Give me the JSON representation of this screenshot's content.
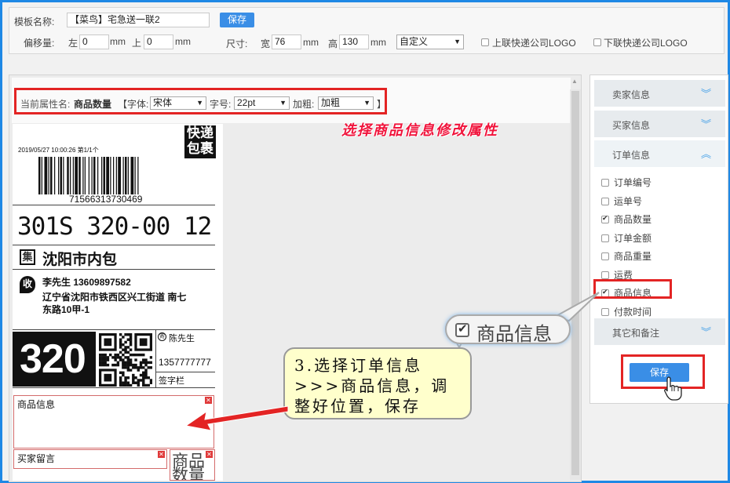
{
  "settings": {
    "template_name_label": "模板名称:",
    "template_name_value": "【菜鸟】宅急送一联2",
    "save_label": "保存",
    "offset_label": "偏移量:",
    "left_label": "左",
    "left_value": "0",
    "top_label": "上",
    "top_value": "0",
    "mm_label": "mm",
    "size_label": "尺寸:",
    "width_label": "宽",
    "width_value": "76",
    "height_label": "高",
    "height_value": "130",
    "preset_value": "自定义",
    "upper_logo_label": "上联快递公司LOGO",
    "lower_logo_label": "下联快递公司LOGO"
  },
  "propbar": {
    "prefix": "当前属性名:",
    "name": "商品数量",
    "open": "【字体:",
    "font_value": "宋体",
    "size_label": "字号:",
    "size_value": "22pt",
    "bold_label": "加粗:",
    "bold_value": "加粗",
    "close": "】"
  },
  "annotation_top": "选择商品信息修改属性",
  "label": {
    "datetime": "2019/05/27  10:00:26   第1/1个",
    "brand_line1": "快递",
    "brand_line2": "包裹",
    "tracking_number": "71566313730469",
    "sort_code": "301S 320-00 12",
    "collect_icon": "集",
    "destination": "沈阳市内包",
    "receive_icon": "收",
    "receiver_name_phone": "李先生    13609897582",
    "address_line1": "辽宁省沈阳市铁西区兴工街道 南七",
    "address_line2": "东路10甲-1",
    "big_code": "320",
    "sender_icon": "寄",
    "sender_name": "陈先生",
    "sender_phone": "1357777777",
    "signature_label": "签字栏",
    "product_info_field": "商品信息",
    "buyer_message_field": "买家留言",
    "overlay_text_1": "商品",
    "overlay_text_2": "数量"
  },
  "side": {
    "seller_info": "卖家信息",
    "buyer_info": "买家信息",
    "order_info": "订单信息",
    "options": [
      {
        "label": "订单编号",
        "checked": false
      },
      {
        "label": "运单号",
        "checked": false
      },
      {
        "label": "商品数量",
        "checked": true
      },
      {
        "label": "订单金额",
        "checked": false
      },
      {
        "label": "商品重量",
        "checked": false
      },
      {
        "label": "运费",
        "checked": false
      },
      {
        "label": "商品信息",
        "checked": true
      },
      {
        "label": "付款时间",
        "checked": false
      }
    ],
    "other_notes": "其它和备注",
    "save_label": "保存"
  },
  "callout_bubble": "商品信息",
  "callout_note": "3.选择订单信息>>>商品信息，调整好位置，保存",
  "colors": {
    "accent": "#3a8ee6",
    "highlight": "#e32424",
    "note_bg": "#ffffcc"
  }
}
